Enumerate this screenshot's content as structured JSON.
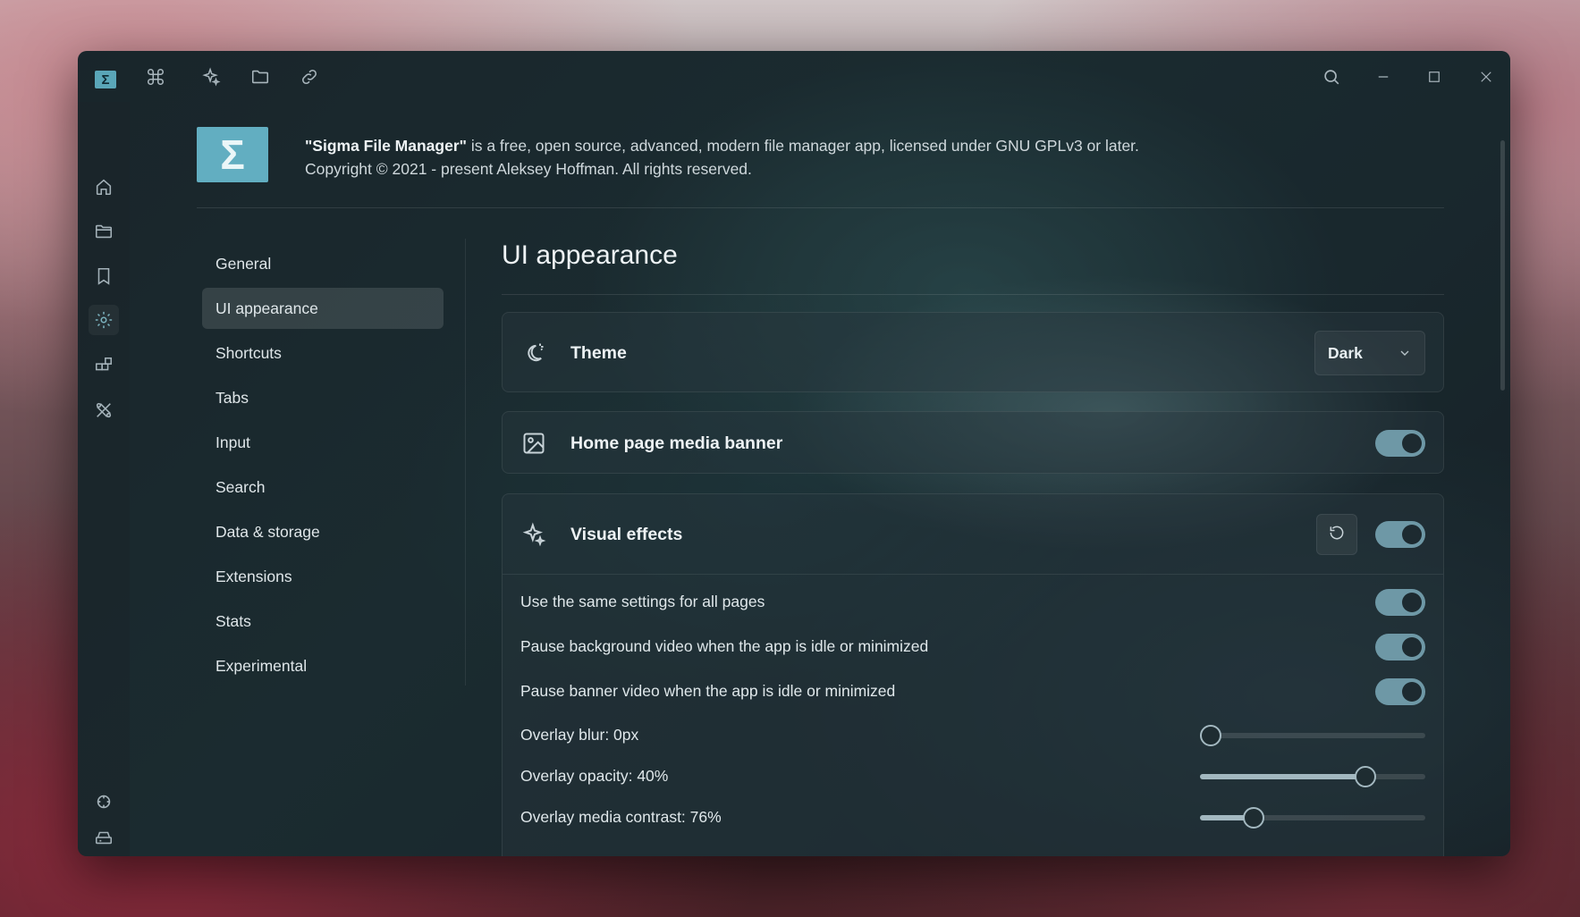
{
  "titlebar": {
    "app_logo_symbol": "Σ",
    "icons": [
      "command-icon",
      "sparkles-icon",
      "folder-icon",
      "link-icon"
    ],
    "window_controls": [
      "search-icon",
      "minimize-icon",
      "maximize-icon",
      "close-icon"
    ]
  },
  "rail": {
    "top_items": [
      "home-icon",
      "folder-icon",
      "bookmark-icon",
      "settings-icon",
      "extensions-icon",
      "tools-icon"
    ],
    "active_item": "settings-icon",
    "bottom_items": [
      "sync-icon",
      "drive-icon",
      "drive-icon-2"
    ]
  },
  "about": {
    "logo_symbol": "Σ",
    "app_name": "\"Sigma File Manager\"",
    "description": " is a free, open source, advanced, modern file manager app, licensed under GNU GPLv3 or later.",
    "copyright": "Copyright © 2021 - present Aleksey Hoffman. All rights reserved."
  },
  "nav": {
    "items": [
      "General",
      "UI appearance",
      "Shortcuts",
      "Tabs",
      "Input",
      "Search",
      "Data & storage",
      "Extensions",
      "Stats",
      "Experimental"
    ],
    "active": "UI appearance"
  },
  "main": {
    "title": "UI appearance",
    "theme": {
      "label": "Theme",
      "value": "Dark"
    },
    "media_banner": {
      "label": "Home page media banner",
      "enabled": true
    },
    "visual_effects": {
      "label": "Visual effects",
      "enabled": true,
      "toggles": [
        {
          "label": "Use the same settings for all pages",
          "enabled": true
        },
        {
          "label": "Pause background video when the app is idle or minimized",
          "enabled": true
        },
        {
          "label": "Pause banner video when the app is idle or minimized",
          "enabled": true
        }
      ],
      "sliders": [
        {
          "label": "Overlay blur: 0px",
          "value": 0
        },
        {
          "label": "Overlay opacity: 40%",
          "value": 0.76
        },
        {
          "label": "Overlay media contrast: 76%",
          "value": 0.21
        }
      ]
    }
  },
  "colors": {
    "accent": "#6e98a6",
    "logo": "#62aec1",
    "toggle_knob": "#1d2a30"
  }
}
